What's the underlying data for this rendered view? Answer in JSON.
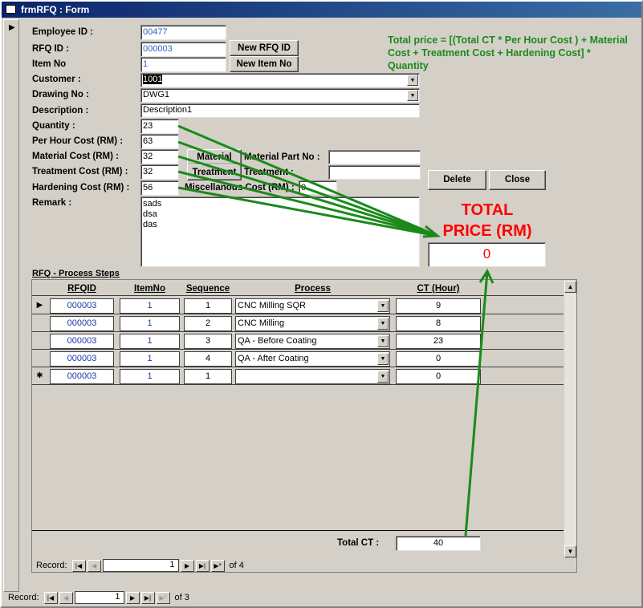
{
  "window": {
    "title": "frmRFQ : Form"
  },
  "form": {
    "employee_id": {
      "label": "Employee ID :",
      "value": "00477"
    },
    "rfq_id": {
      "label": "RFQ ID :",
      "value": "000003"
    },
    "item_no": {
      "label": "Item No",
      "value": "1"
    },
    "customer": {
      "label": "Customer :",
      "value": "1001"
    },
    "drawing_no": {
      "label": "Drawing No :",
      "value": "DWG1"
    },
    "description": {
      "label": "Description :",
      "value": "Description1"
    },
    "quantity": {
      "label": "Quantity :",
      "value": "23"
    },
    "per_hour_cost": {
      "label": "Per Hour Cost (RM) :",
      "value": "63"
    },
    "material_cost": {
      "label": "Material Cost (RM) :",
      "value": "32"
    },
    "treatment_cost": {
      "label": "Treatment Cost (RM) :",
      "value": "32"
    },
    "hardening_cost": {
      "label": "Hardening Cost (RM) :",
      "value": "56"
    },
    "misc_cost": {
      "label": "Miscellanous Cost (RM) :",
      "value": "0"
    },
    "material_part_no": {
      "label": "Material Part No :",
      "value": ""
    },
    "treatment": {
      "label": "Treatment :",
      "value": ""
    },
    "remark": {
      "label": "Remark :",
      "value": "sads\ndsa\ndas"
    }
  },
  "buttons": {
    "new_rfq_id": "New RFQ ID",
    "new_item_no": "New Item No",
    "material": "Material",
    "treatment": "Treatment",
    "delete": "Delete",
    "close": "Close"
  },
  "annotation": {
    "formula": "Total price = [(Total CT * Per Hour Cost ) + Material Cost + Treatment Cost + Hardening Cost] * Quantity",
    "total_price_label": "TOTAL PRICE (RM)",
    "total_price_value": "0",
    "colors": {
      "arrow": "#1a8a1a",
      "total": "#ff0000"
    }
  },
  "subform": {
    "title": "RFQ - Process Steps",
    "columns": [
      "RFQID",
      "ItemNo",
      "Sequence",
      "Process",
      "CT (Hour)"
    ],
    "rows": [
      {
        "rfqid": "000003",
        "itemno": "1",
        "sequence": "1",
        "process": "CNC Milling SQR",
        "ct": "9"
      },
      {
        "rfqid": "000003",
        "itemno": "1",
        "sequence": "2",
        "process": "CNC Milling",
        "ct": "8"
      },
      {
        "rfqid": "000003",
        "itemno": "1",
        "sequence": "3",
        "process": "QA - Before Coating",
        "ct": "23"
      },
      {
        "rfqid": "000003",
        "itemno": "1",
        "sequence": "4",
        "process": "QA - After Coating",
        "ct": "0"
      },
      {
        "rfqid": "000003",
        "itemno": "1",
        "sequence": "1",
        "process": "",
        "ct": "0"
      }
    ],
    "total_ct_label": "Total CT :",
    "total_ct": "40",
    "nav": {
      "label": "Record:",
      "current": "1",
      "of": "of 4"
    }
  },
  "main_nav": {
    "label": "Record:",
    "current": "1",
    "of": "of 3"
  }
}
